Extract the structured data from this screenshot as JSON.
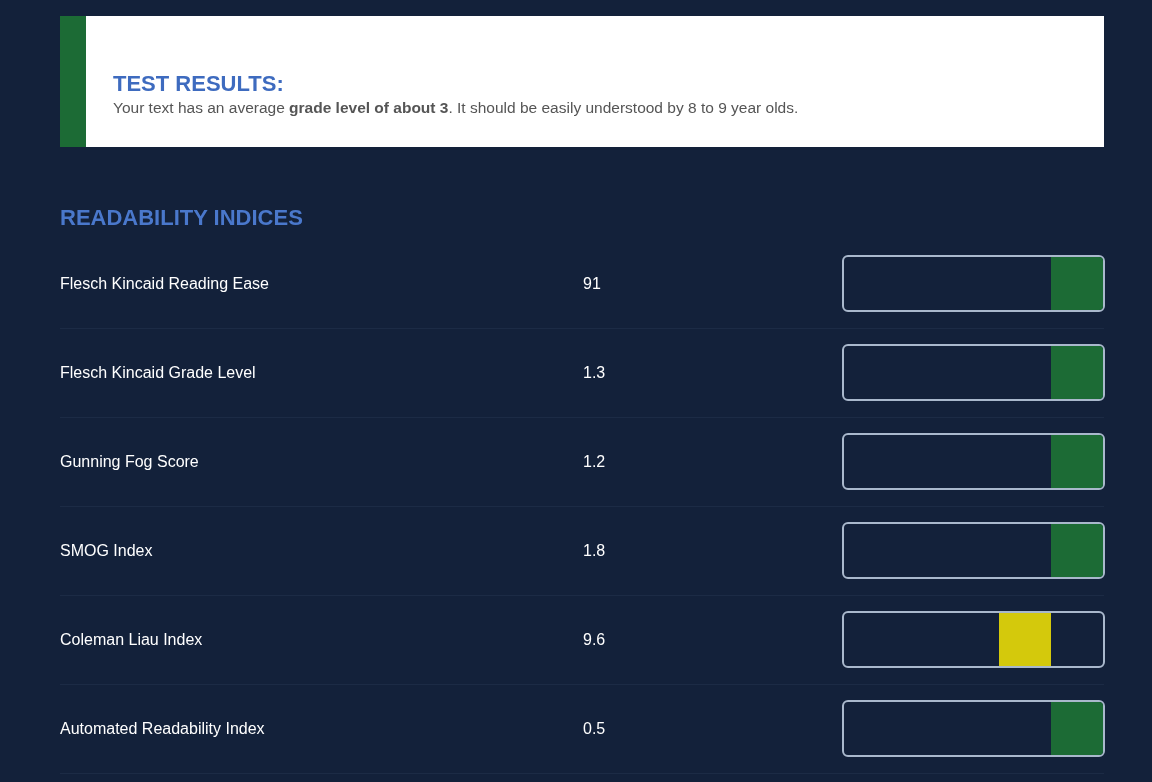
{
  "result": {
    "title": "TEST RESULTS:",
    "text": "Your text has an average **grade level of about 3**. It should be easily understood by 8 to 9 year olds."
  },
  "section_title": "READABILITY INDICES",
  "indices": [
    {
      "name": "Flesch Kincaid Reading Ease",
      "score": "91",
      "level": 1.0,
      "color": "#1c6b35"
    },
    {
      "name": "Flesch Kincaid Grade Level",
      "score": "1.3",
      "level": 1.0,
      "color": "#1c6b35"
    },
    {
      "name": "Gunning Fog Score",
      "score": "1.2",
      "level": 1.0,
      "color": "#1c6b35"
    },
    {
      "name": "SMOG Index",
      "score": "1.8",
      "level": 1.0,
      "color": "#1c6b35"
    },
    {
      "name": "Coleman Liau Index",
      "score": "9.6",
      "level": 0.8,
      "color": "#d4c90c"
    },
    {
      "name": "Automated Readability Index",
      "score": "0.5",
      "level": 1.0,
      "color": "#1c6b35"
    }
  ]
}
